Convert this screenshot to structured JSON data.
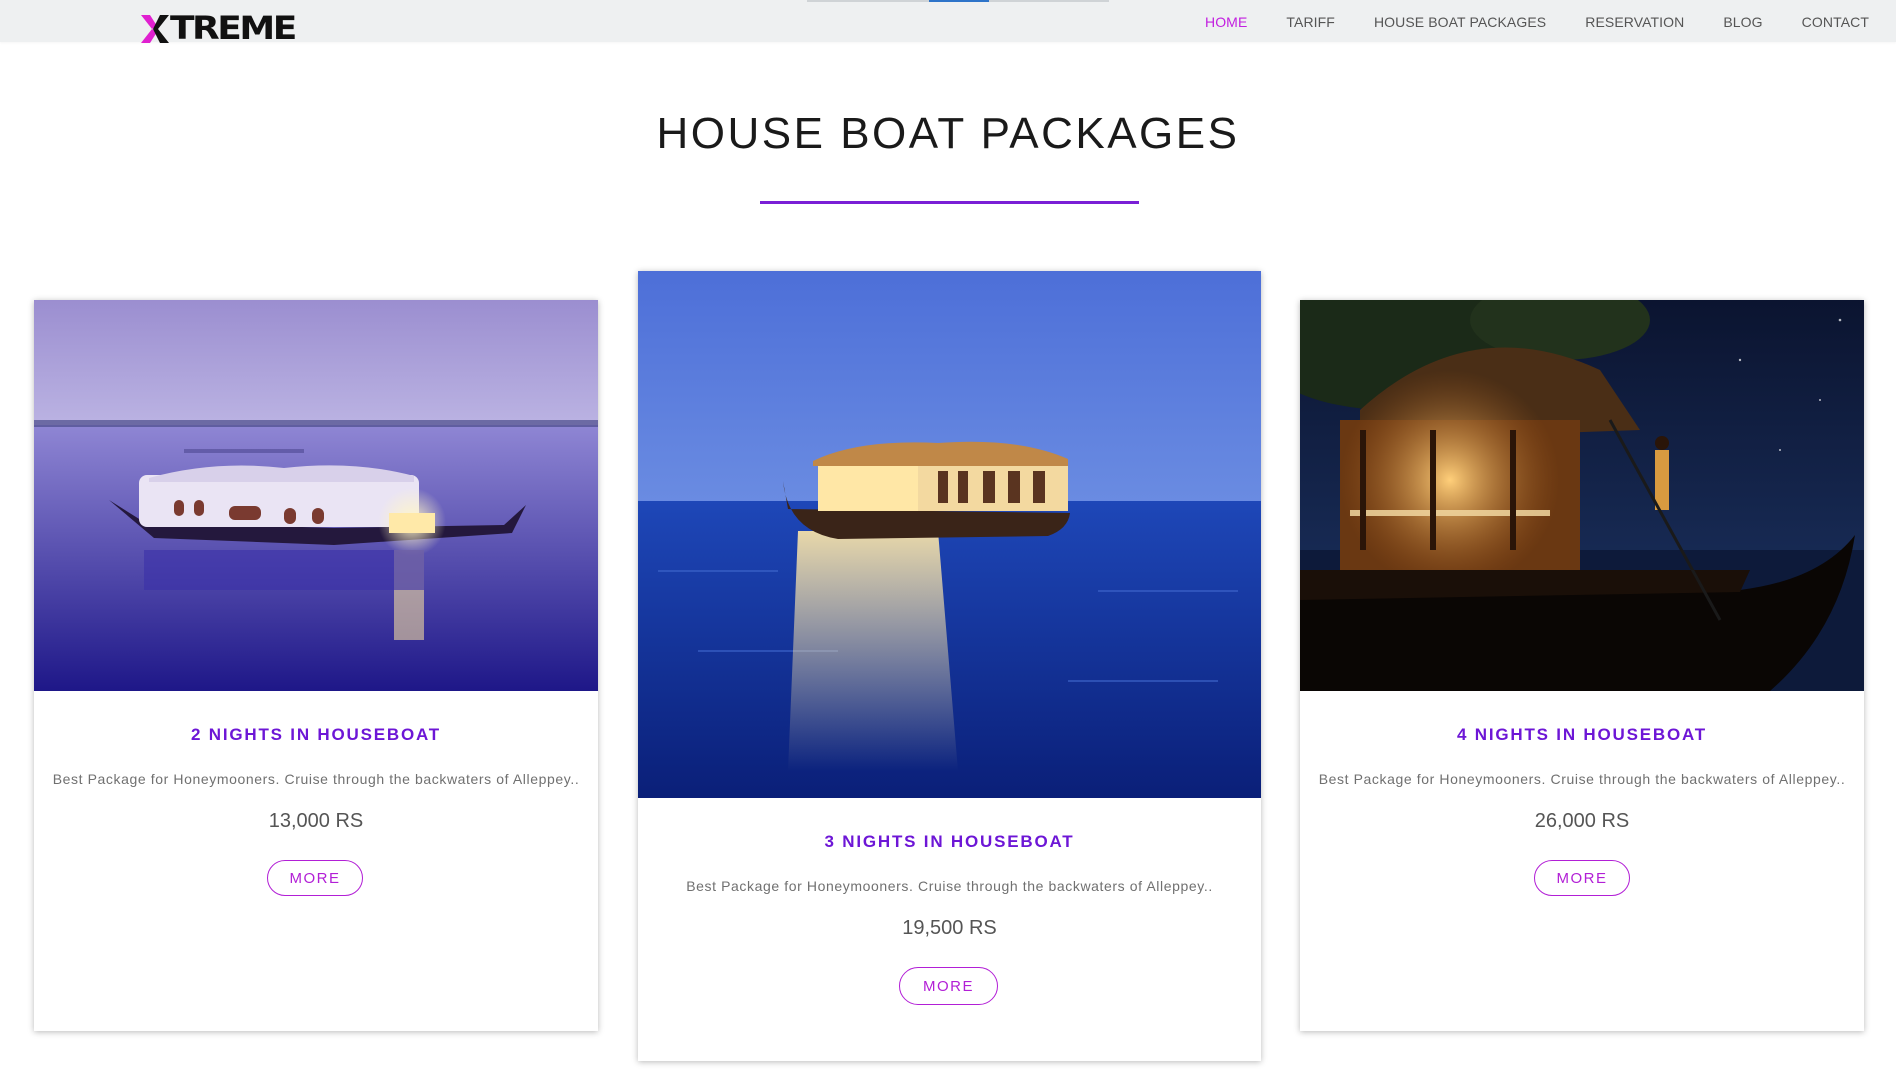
{
  "brand": {
    "logo_text": "TREME",
    "logo_x_colors": {
      "left": "#e020d0",
      "right": "#111111"
    }
  },
  "nav": {
    "items": [
      {
        "label": "HOME",
        "active": true
      },
      {
        "label": "TARIFF",
        "active": false
      },
      {
        "label": "HOUSE BOAT PACKAGES",
        "active": false
      },
      {
        "label": "RESERVATION",
        "active": false
      },
      {
        "label": "BLOG",
        "active": false
      },
      {
        "label": "CONTACT",
        "active": false
      }
    ],
    "active_color": "#c21fe0",
    "text_color": "#555555"
  },
  "section": {
    "title": "HOUSE BOAT PACKAGES",
    "underline_color": "#7a1fd6"
  },
  "packages": [
    {
      "title": "2 NIGHTS IN HOUSEBOAT",
      "description": "Best Package for Honeymooners. Cruise through the backwaters of Alleppey..",
      "price": "13,000 RS",
      "button": "MORE",
      "image": "houseboat-sunset-image"
    },
    {
      "title": "3 NIGHTS IN HOUSEBOAT",
      "description": "Best Package for Honeymooners. Cruise through the backwaters of Alleppey..",
      "price": "19,500 RS",
      "button": "MORE",
      "image": "houseboat-blue-water-image"
    },
    {
      "title": "4 NIGHTS IN HOUSEBOAT",
      "description": "Best Package for Honeymooners. Cruise through the backwaters of Alleppey..",
      "price": "26,000 RS",
      "button": "MORE",
      "image": "houseboat-night-image"
    }
  ],
  "colors": {
    "accent_purple": "#6d16d6",
    "button_magenta": "#b21fd6",
    "navbar_bg": "#eef0f1"
  }
}
